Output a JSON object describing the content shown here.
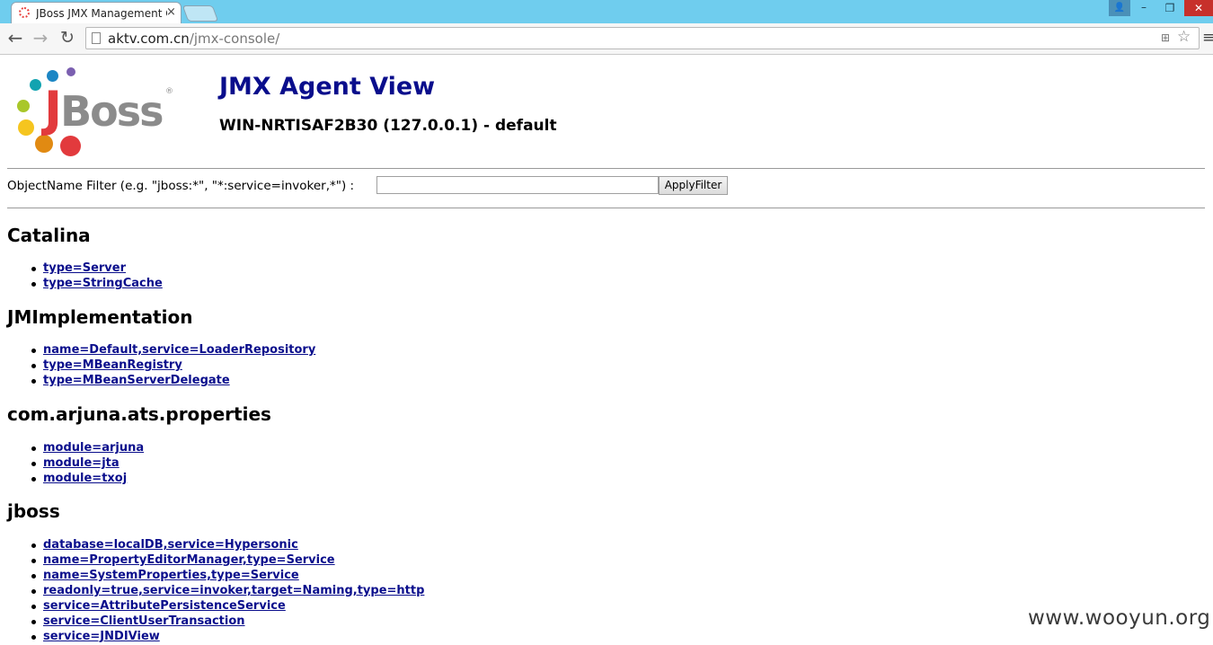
{
  "browser": {
    "tab_title": "JBoss JMX Management Console",
    "tab_close": "×",
    "url_host": "aktv.com.cn",
    "url_path": "/jmx-console/",
    "icons": {
      "back": "←",
      "forward": "→",
      "reload": "↻",
      "star": "☆",
      "menu": "≡",
      "translate": "⊞",
      "user": "👤",
      "minimize": "–",
      "maximize": "❐",
      "close": "✕"
    }
  },
  "logo": {
    "text_j": "J",
    "text_rest": "Boss",
    "registered": "®",
    "colors": {
      "j": "#e23a3d",
      "boss": "#8b8b8b",
      "dots": [
        "#7b5fb0",
        "#1c86c4",
        "#12a3b0",
        "#a9c72a",
        "#f5c51f",
        "#e18a12",
        "#e23a3d"
      ]
    }
  },
  "header": {
    "title": "JMX Agent View",
    "subtitle": "WIN-NRTISAF2B30 (127.0.0.1) - default"
  },
  "filter": {
    "label": "ObjectName Filter (e.g. \"jboss:*\", \"*:service=invoker,*\") :",
    "value": "",
    "button_label": "ApplyFilter"
  },
  "domains": [
    {
      "name": "Catalina",
      "mbeans": [
        "type=Server",
        "type=StringCache"
      ]
    },
    {
      "name": "JMImplementation",
      "mbeans": [
        "name=Default,service=LoaderRepository",
        "type=MBeanRegistry",
        "type=MBeanServerDelegate"
      ]
    },
    {
      "name": "com.arjuna.ats.properties",
      "mbeans": [
        "module=arjuna",
        "module=jta",
        "module=txoj"
      ]
    },
    {
      "name": "jboss",
      "mbeans": [
        "database=localDB,service=Hypersonic",
        "name=PropertyEditorManager,type=Service",
        "name=SystemProperties,type=Service",
        "readonly=true,service=invoker,target=Naming,type=http",
        "service=AttributePersistenceService",
        "service=ClientUserTransaction",
        "service=JNDIView"
      ]
    }
  ],
  "watermark": "www.wooyun.org",
  "colors": {
    "link": "#0a0e8c",
    "title": "#0a0e8c",
    "titlebar": "#6fcdee"
  }
}
